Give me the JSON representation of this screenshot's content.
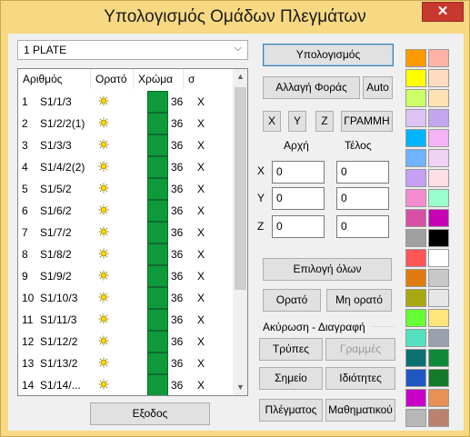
{
  "window": {
    "title": "Υπολογισμός Ομάδων Πλεγμάτων",
    "close_glyph": "✕"
  },
  "plate_select": {
    "value": "1 PLATE",
    "arrow_glyph": "⌵"
  },
  "list": {
    "columns": [
      "Αριθμός",
      "Ορατό",
      "Χρώμα",
      "σ"
    ],
    "rows": [
      {
        "num": "1",
        "name": "S1/1/3",
        "color": "36",
        "s": "X"
      },
      {
        "num": "2",
        "name": "S1/2/2(1)",
        "color": "36",
        "s": "X"
      },
      {
        "num": "3",
        "name": "S1/3/3",
        "color": "36",
        "s": "X"
      },
      {
        "num": "4",
        "name": "S1/4/2(2)",
        "color": "36",
        "s": "X"
      },
      {
        "num": "5",
        "name": "S1/5/2",
        "color": "36",
        "s": "X"
      },
      {
        "num": "6",
        "name": "S1/6/2",
        "color": "36",
        "s": "X"
      },
      {
        "num": "7",
        "name": "S1/7/2",
        "color": "36",
        "s": "X"
      },
      {
        "num": "8",
        "name": "S1/8/2",
        "color": "36",
        "s": "X"
      },
      {
        "num": "9",
        "name": "S1/9/2",
        "color": "36",
        "s": "X"
      },
      {
        "num": "10",
        "name": "S1/10/3",
        "color": "36",
        "s": "X"
      },
      {
        "num": "11",
        "name": "S1/11/3",
        "color": "36",
        "s": "X"
      },
      {
        "num": "12",
        "name": "S1/12/2",
        "color": "36",
        "s": "X"
      },
      {
        "num": "13",
        "name": "S1/13/2",
        "color": "36",
        "s": "X"
      },
      {
        "num": "14",
        "name": "S1/14/...",
        "color": "36",
        "s": "X"
      }
    ],
    "swatch_color": "#0f9a3a",
    "visible_icon": "sun-icon"
  },
  "buttons": {
    "calculate": "Υπολογισμός",
    "change_direction": "Αλλαγή Φοράς",
    "auto": "Auto",
    "x": "X",
    "y": "Y",
    "z": "Z",
    "line": "ΓΡΑΜΜΗ",
    "select_all": "Επιλογή όλων",
    "visible": "Ορατό",
    "not_visible": "Μη ορατό",
    "holes": "Τρύπες",
    "lines": "Γραμμές",
    "point": "Σημείο",
    "properties": "Ιδιότητες",
    "mesh": "Πλέγματος",
    "math": "Μαθηματικού",
    "exit": "Εξοδος"
  },
  "coords": {
    "start_label": "Αρχή",
    "end_label": "Τέλος",
    "x_label": "X",
    "y_label": "Y",
    "z_label": "Z",
    "x_start": "0",
    "x_end": "0",
    "y_start": "0",
    "y_end": "0",
    "z_start": "0",
    "z_end": "0"
  },
  "cancel_delete_group": {
    "title": "Ακύρωση - Διαγραφή"
  },
  "palette": [
    [
      "#ff9900",
      "#ffb3a8"
    ],
    [
      "#ffff00",
      "#ffdcc0"
    ],
    [
      "#ccff66",
      "#ffe2b3"
    ],
    [
      "#ddc2f3",
      "#c3a6ee"
    ],
    [
      "#00b4ff",
      "#f7b3f7"
    ],
    [
      "#70b3ff",
      "#f0d2f5"
    ],
    [
      "#c5a0f5",
      "#ffdee6"
    ],
    [
      "#f58ccf",
      "#99ffcc"
    ],
    [
      "#d64fa5",
      "#c800b4"
    ],
    [
      "#a0a0a0",
      "#000000"
    ],
    [
      "#ff5555",
      "#ffffff"
    ],
    [
      "#e07b10",
      "#c8c8c8"
    ],
    [
      "#a8a810",
      "#e6e6e6"
    ],
    [
      "#66ff33",
      "#ffe57a"
    ],
    [
      "#55e0c0",
      "#9aa0ad"
    ],
    [
      "#0a7070",
      "#0e8a3a"
    ],
    [
      "#1f57c2",
      "#147a2a"
    ],
    [
      "#c800c8",
      "#e89055"
    ],
    [
      "#b8b8b8",
      "#b8826e"
    ]
  ]
}
